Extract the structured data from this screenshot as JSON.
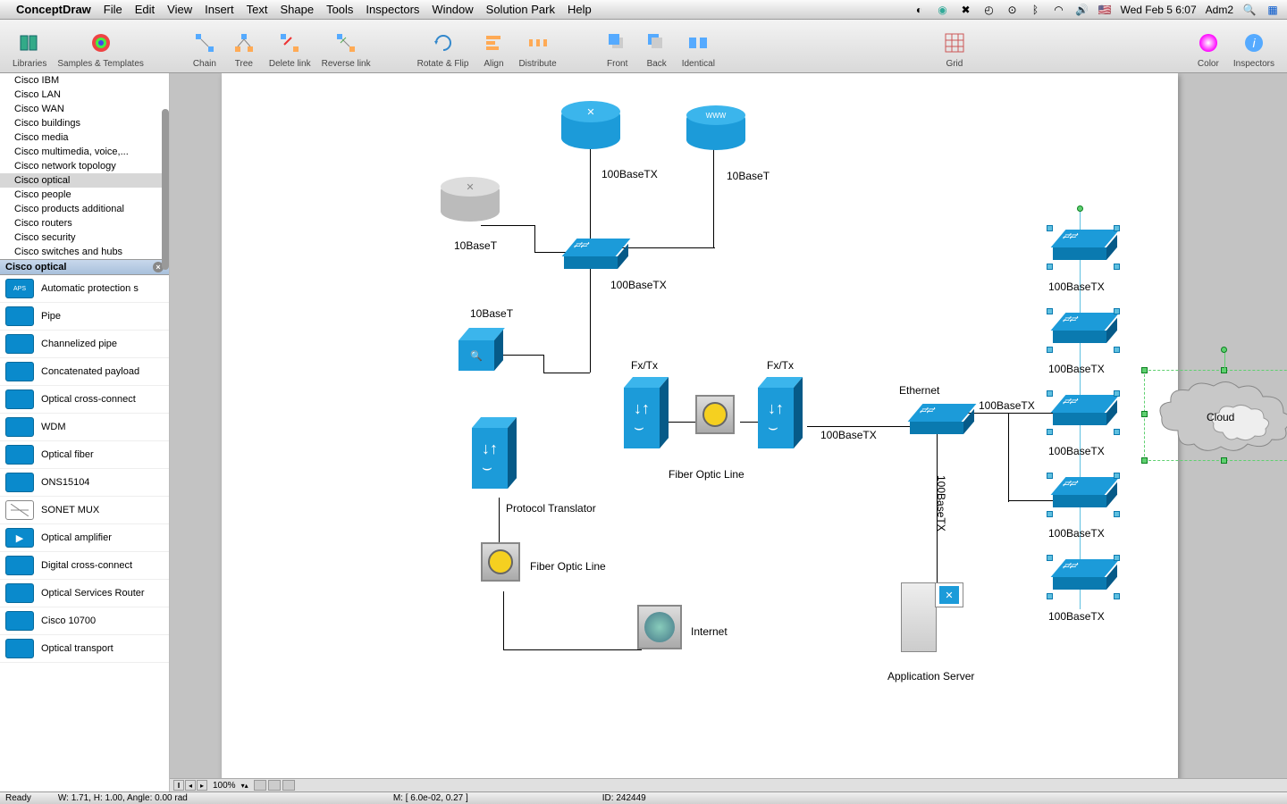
{
  "menubar": {
    "app": "ConceptDraw",
    "items": [
      "File",
      "Edit",
      "View",
      "Insert",
      "Text",
      "Shape",
      "Tools",
      "Inspectors",
      "Window",
      "Solution Park",
      "Help"
    ],
    "right": {
      "datetime": "Wed Feb 5  6:07",
      "user": "Adm2",
      "flag": "🇺🇸"
    }
  },
  "toolbar": {
    "items": [
      {
        "id": "libraries",
        "label": "Libraries"
      },
      {
        "id": "samples",
        "label": "Samples & Templates"
      },
      {
        "id": "chain",
        "label": "Chain"
      },
      {
        "id": "tree",
        "label": "Tree"
      },
      {
        "id": "deletelink",
        "label": "Delete link"
      },
      {
        "id": "reverselink",
        "label": "Reverse link"
      },
      {
        "id": "rotateflip",
        "label": "Rotate & Flip"
      },
      {
        "id": "align",
        "label": "Align"
      },
      {
        "id": "distribute",
        "label": "Distribute"
      },
      {
        "id": "front",
        "label": "Front"
      },
      {
        "id": "back",
        "label": "Back"
      },
      {
        "id": "identical",
        "label": "Identical"
      },
      {
        "id": "grid",
        "label": "Grid"
      },
      {
        "id": "color",
        "label": "Color"
      },
      {
        "id": "inspectors",
        "label": "Inspectors"
      }
    ]
  },
  "libtree": {
    "items": [
      "Cisco IBM",
      "Cisco LAN",
      "Cisco WAN",
      "Cisco buildings",
      "Cisco media",
      "Cisco multimedia, voice,...",
      "Cisco network topology",
      "Cisco optical",
      "Cisco people",
      "Cisco products additional",
      "Cisco routers",
      "Cisco security",
      "Cisco switches and hubs"
    ],
    "selected": "Cisco optical"
  },
  "libheader": "Cisco optical",
  "stencils": [
    "Automatic protection s",
    "Pipe",
    "Channelized pipe",
    "Concatenated payload",
    "Optical cross-connect",
    "WDM",
    "Optical fiber",
    "ONS15104",
    "SONET MUX",
    "Optical amplifier",
    "Digital cross-connect",
    "Optical Services Router",
    "Cisco 10700",
    "Optical transport"
  ],
  "diagram": {
    "labels": {
      "l1": "100BaseTX",
      "l2": "10BaseT",
      "l3": "10BaseT",
      "l4": "100BaseTX",
      "l5": "10BaseT",
      "l6": "Fx/Tx",
      "l7": "Fx/Tx",
      "l8": "Fiber Optic Line",
      "l9": "Protocol Translator",
      "l10": "Fiber Optic Line",
      "l11": "Internet",
      "l12": "Ethernet",
      "l13": "100BaseTX",
      "l14": "100BaseTX",
      "l15": "Application Server",
      "l16": "100BaseTX",
      "l17": "100BaseTX",
      "l18": "100BaseTX",
      "l19": "100BaseTX",
      "l20": "100BaseTX",
      "l21": "Cloud",
      "l22": "100BaseTX"
    }
  },
  "hbar": {
    "zoom": "100%"
  },
  "status": {
    "ready": "Ready",
    "dims": "W: 1.71,  H: 1.00,  Angle: 0.00 rad",
    "mouse": "M: [ 6.0e-02, 0.27 ]",
    "id": "ID: 242449"
  }
}
